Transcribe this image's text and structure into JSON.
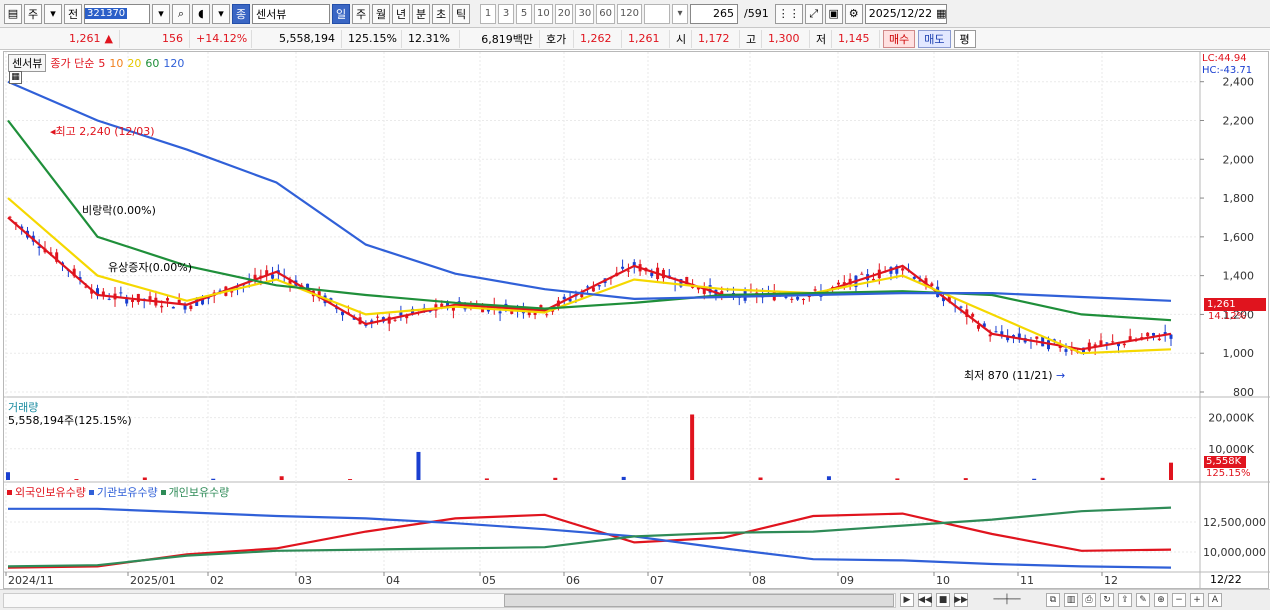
{
  "toolbar": {
    "market_label": "주",
    "type_label": "전",
    "code": "321370",
    "stock_icon_label": "종",
    "stock_name": "센서뷰",
    "periods": [
      "일",
      "주",
      "월",
      "년",
      "분",
      "초",
      "틱"
    ],
    "active_period": "일",
    "intervals": [
      "1",
      "3",
      "5",
      "10",
      "20",
      "30",
      "60",
      "120"
    ],
    "count": "265",
    "total": "/591",
    "date": "2025/12/22"
  },
  "quote": {
    "price": "1,261",
    "change_arrow": "▲",
    "change": "156",
    "change_pct": "+14.12%",
    "volume": "5,558,194",
    "volume_pct": "125.15%",
    "turnover": "12.31%",
    "amount": "6,819백만",
    "ask_label": "호가",
    "ask": "1,262",
    "bid": "1,261",
    "open_label": "시",
    "open": "1,172",
    "high_label": "고",
    "high": "1,300",
    "low_label": "저",
    "low": "1,145",
    "buy_label": "매수",
    "sell_label": "매도",
    "eval_label": "평"
  },
  "legend": {
    "name": "센서뷰",
    "ma_title": "종가 단순",
    "ma_periods": [
      "5",
      "10",
      "20",
      "60",
      "120"
    ],
    "ma_colors": [
      "#e0141e",
      "#f0801e",
      "#f5d800",
      "#1f8f3a",
      "#3060d8"
    ]
  },
  "annotations": {
    "high": "최고 2,240 (12/03)",
    "low": "최저 870 (11/21)",
    "event1": "비랑락(0.00%)",
    "event2": "유상증자(0.00%)",
    "lc": "LC:44.94",
    "hc": "HC:-43.71",
    "last_price": "1,261",
    "last_pct": "14.12%"
  },
  "volume_panel": {
    "title": "거래량",
    "value": "5,558,194주(125.15%)",
    "last_badge": "5,558K",
    "last_pct": "125.15%"
  },
  "holdings_panel": {
    "series_names": [
      "외국인보유수량",
      "기관보유수량",
      "개인보유수량"
    ],
    "series_colors": [
      "#e0141e",
      "#3060d8",
      "#2e8b57"
    ]
  },
  "axis": {
    "price_ticks": [
      "2,400",
      "2,200",
      "2,000",
      "1,800",
      "1,600",
      "1,400",
      "1,200",
      "1,000",
      "800"
    ],
    "volume_ticks": [
      "20,000K",
      "10,000K"
    ],
    "holdings_ticks": [
      "12,500,000",
      "10,000,000"
    ],
    "date_ticks": [
      "2024/11",
      "2025/01",
      "02",
      "03",
      "04",
      "05",
      "06",
      "07",
      "08",
      "09",
      "10",
      "11",
      "12"
    ],
    "cursor_date": "12/22"
  },
  "chart_data": [
    {
      "type": "line",
      "title": "",
      "ylim": [
        800,
        2450
      ],
      "x": [
        "2024/11",
        "2025/01",
        "02",
        "03",
        "04",
        "05",
        "06",
        "07",
        "08",
        "09",
        "10",
        "11",
        "12",
        "12/22"
      ],
      "series": [
        {
          "name": "5",
          "values": [
            1700,
            1300,
            1250,
            1420,
            1150,
            1250,
            1220,
            1450,
            1300,
            1300,
            1450,
            1100,
            1020,
            1100
          ]
        },
        {
          "name": "20",
          "values": [
            1800,
            1400,
            1270,
            1380,
            1200,
            1240,
            1210,
            1380,
            1330,
            1310,
            1400,
            1200,
            1000,
            1020
          ]
        },
        {
          "name": "60",
          "values": [
            2200,
            1600,
            1450,
            1350,
            1300,
            1260,
            1230,
            1260,
            1300,
            1310,
            1320,
            1300,
            1200,
            1170
          ]
        },
        {
          "name": "120",
          "values": [
            2400,
            2200,
            2050,
            1880,
            1560,
            1410,
            1330,
            1280,
            1290,
            1300,
            1310,
            1310,
            1290,
            1270
          ]
        }
      ]
    },
    {
      "type": "bar",
      "title": "거래량",
      "ylim": [
        0,
        25000
      ],
      "values": [
        2500,
        300,
        800,
        400,
        1200,
        300,
        9000,
        500,
        700,
        1000,
        21000,
        800,
        1200,
        500,
        600,
        400,
        700,
        5558
      ]
    },
    {
      "type": "line",
      "title": "",
      "ylim": [
        8500000,
        14500000
      ],
      "series": [
        {
          "name": "외국인보유수량",
          "values": [
            8700000,
            8800000,
            9800000,
            10300000,
            11700000,
            12800000,
            13100000,
            10800000,
            11200000,
            13000000,
            13200000,
            11500000,
            10100000,
            10200000
          ]
        },
        {
          "name": "기관보유수량",
          "values": [
            13600000,
            13600000,
            13300000,
            13000000,
            12800000,
            12400000,
            11900000,
            11300000,
            10300000,
            9400000,
            9300000,
            9000000,
            8800000,
            8700000
          ]
        },
        {
          "name": "개인보유수량",
          "values": [
            8800000,
            8900000,
            9700000,
            10100000,
            10200000,
            10300000,
            10400000,
            11300000,
            11600000,
            11700000,
            12200000,
            12700000,
            13400000,
            13700000
          ]
        }
      ]
    }
  ]
}
